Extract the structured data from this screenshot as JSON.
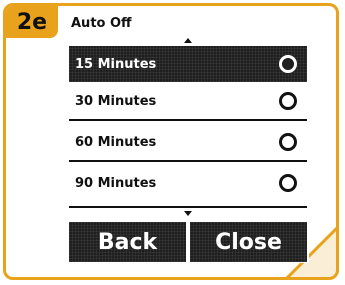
{
  "badge": "2e",
  "menu": {
    "title": "Auto Off",
    "items": [
      {
        "label": "15 Minutes",
        "selected": true
      },
      {
        "label": "30 Minutes",
        "selected": false
      },
      {
        "label": "60 Minutes",
        "selected": false
      },
      {
        "label": "90 Minutes",
        "selected": false
      }
    ]
  },
  "buttons": {
    "back": "Back",
    "close": "Close"
  },
  "colors": {
    "accent": "#e8a21c",
    "selection": "#1f1f1f"
  }
}
